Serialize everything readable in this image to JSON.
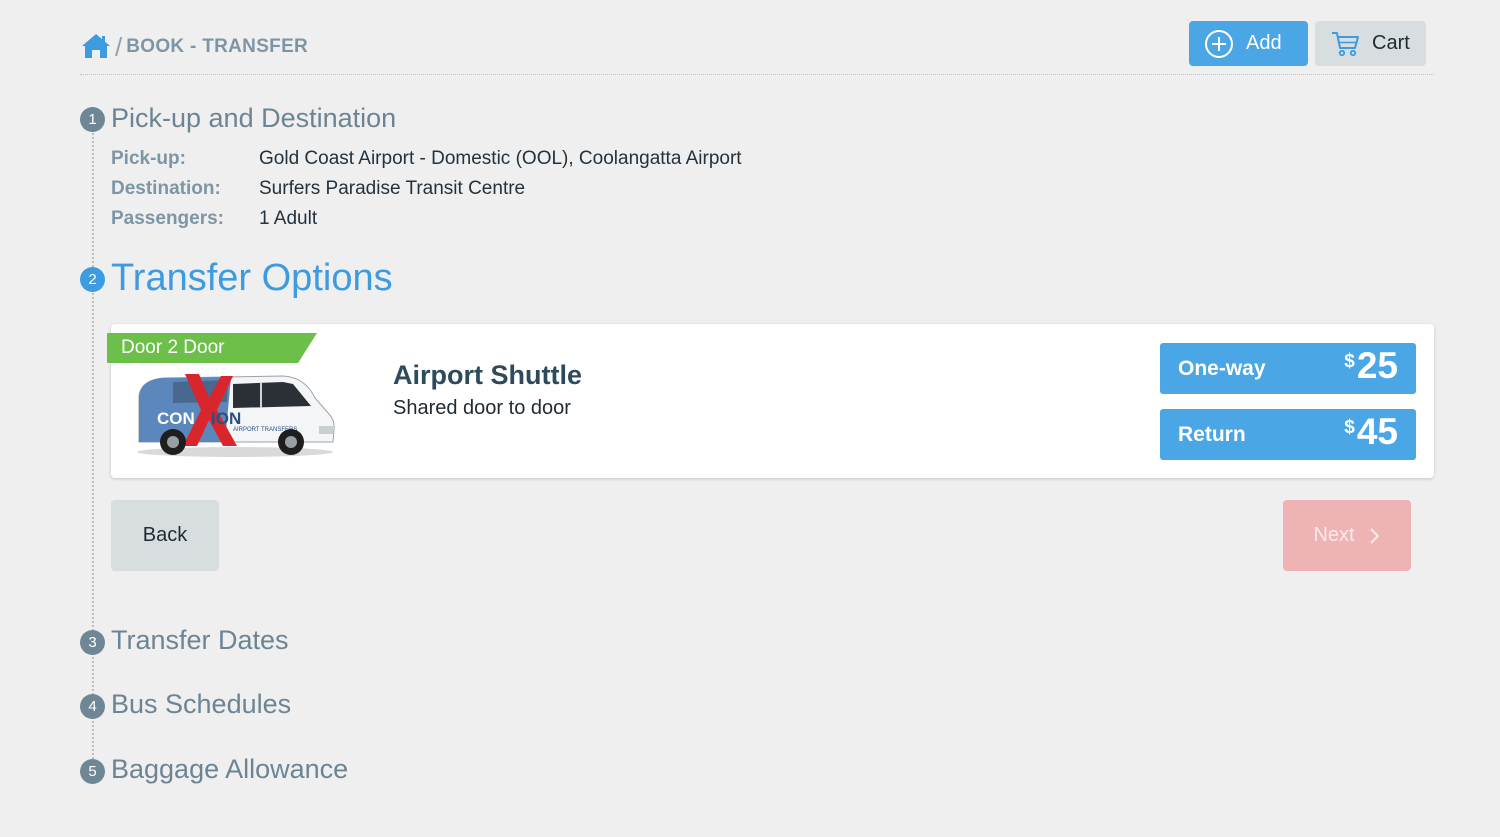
{
  "breadcrumb": {
    "separator": "/",
    "label": "BOOK - TRANSFER"
  },
  "header": {
    "add_label": "Add",
    "cart_label": "Cart"
  },
  "steps": [
    {
      "num": "1",
      "title": "Pick-up and Destination"
    },
    {
      "num": "2",
      "title": "Transfer Options"
    },
    {
      "num": "3",
      "title": "Transfer Dates"
    },
    {
      "num": "4",
      "title": "Bus Schedules"
    },
    {
      "num": "5",
      "title": "Baggage Allowance"
    }
  ],
  "details": [
    {
      "label": "Pick-up:",
      "value": "Gold Coast Airport - Domestic (OOL), Coolangatta Airport"
    },
    {
      "label": "Destination:",
      "value": "Surfers Paradise Transit Centre"
    },
    {
      "label": "Passengers:",
      "value": "1 Adult"
    }
  ],
  "option": {
    "ribbon": "Door 2 Door",
    "title": "Airport Shuttle",
    "subtitle": "Shared door to door",
    "van_text": "CON-X-ION",
    "prices": [
      {
        "label": "One-way",
        "currency": "$",
        "amount": "25"
      },
      {
        "label": "Return",
        "currency": "$",
        "amount": "45"
      }
    ]
  },
  "nav": {
    "back_label": "Back",
    "next_label": "Next"
  },
  "colors": {
    "accent": "#4ba6e5",
    "ribbon": "#6cc04a",
    "next_disabled": "#eeb4b4",
    "step_inactive": "#6f8795"
  }
}
